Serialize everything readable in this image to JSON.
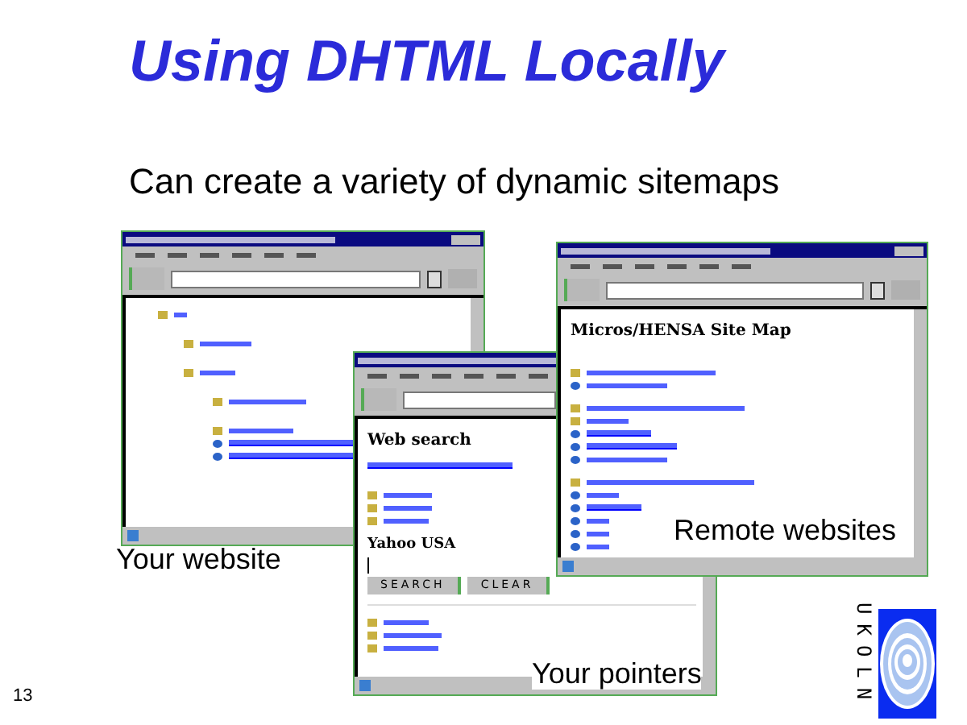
{
  "slide": {
    "title": "Using DHTML Locally",
    "subtitle": "Can create a variety of dynamic sitemaps",
    "page_number": "13"
  },
  "windows": [
    {
      "kind": "tree"
    },
    {
      "kind": "search",
      "heading": "Web search",
      "subheading": "Yahoo USA",
      "buttons": [
        "SEARCH",
        "CLEAR"
      ]
    },
    {
      "kind": "sitemap",
      "heading": "Micros/HENSA Site Map"
    }
  ],
  "captions": [
    "Your website",
    "Remote websites",
    "Your pointers"
  ],
  "logo": {
    "text": "UKOLN"
  }
}
